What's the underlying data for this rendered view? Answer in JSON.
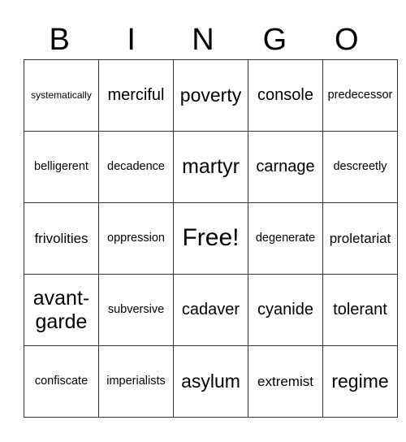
{
  "header": [
    "B",
    "I",
    "N",
    "G",
    "O"
  ],
  "rows": [
    [
      "systematically",
      "merciful",
      "poverty",
      "console",
      "predecessor"
    ],
    [
      "belligerent",
      "decadence",
      "martyr",
      "carnage",
      "descreetly"
    ],
    [
      "frivolities",
      "oppression",
      "Free!",
      "degenerate",
      "proletariat"
    ],
    [
      "avant-garde",
      "subversive",
      "cadaver",
      "cyanide",
      "tolerant"
    ],
    [
      "confiscate",
      "imperialists",
      "asylum",
      "extremist",
      "regime"
    ]
  ]
}
